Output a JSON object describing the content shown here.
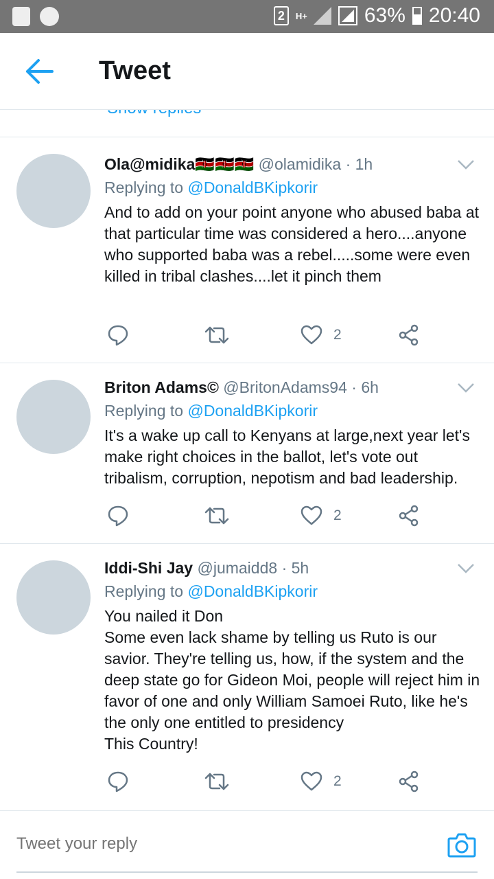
{
  "status_bar": {
    "sim_slot": "2",
    "network": "H+",
    "battery": "63%",
    "time": "20:40"
  },
  "header": {
    "title": "Tweet"
  },
  "partial_above": {
    "text": "Show replies"
  },
  "tweets": [
    {
      "name": "Ola@midika🇰🇪🇰🇪🇰🇪",
      "handle": "@olamidika",
      "time": "· 1h",
      "replying_prefix": "Replying to",
      "replying_to": "@DonaldBKipkorir",
      "text": "And to add on your point anyone who abused baba at that particular time was considered a hero....anyone who supported baba was a rebel.....some were even killed in tribal clashes....let it pinch them  ",
      "likes": "2"
    },
    {
      "name": "Briton Adams©",
      "handle": "@BritonAdams94",
      "time": "· 6h",
      "replying_prefix": "Replying to",
      "replying_to": "@DonaldBKipkorir",
      "text": "It's a wake up call to Kenyans at large,next year let's make right choices in the ballot, let's vote out tribalism, corruption, nepotism and bad leadership.",
      "likes": "2"
    },
    {
      "name": "Iddi-Shi Jay",
      "handle": "@jumaidd8",
      "time": "· 5h",
      "replying_prefix": "Replying to",
      "replying_to": "@DonaldBKipkorir",
      "text": "You nailed it Don\nSome even lack shame by telling us Ruto is our savior. They're telling us, how, if the system and the deep state go for Gideon Moi, people will reject him in favor of one and only William Samoei Ruto, like he's the only one entitled to presidency\nThis Country!",
      "likes": "2"
    }
  ],
  "reply_bar": {
    "placeholder": "Tweet your reply"
  },
  "colors": {
    "accent": "#1da1f2",
    "secondary_text": "#657786",
    "status_bar": "#757575",
    "avatar_placeholder": "#ccd6dd"
  }
}
